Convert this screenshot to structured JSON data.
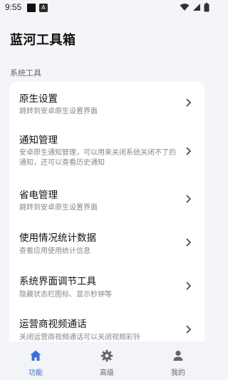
{
  "status_bar": {
    "time": "9:55",
    "notif_icon_2_glyph": "A"
  },
  "app": {
    "title": "蓝河工具箱"
  },
  "section": {
    "title": "系统工具"
  },
  "items": [
    {
      "title": "原生设置",
      "subtitle": "跳转到安卓原生设置界面"
    },
    {
      "title": "通知管理",
      "subtitle": "安卓原生通知管理，可以用来关闭系统关闭不了的通知，还可以查看历史通知"
    },
    {
      "title": "省电管理",
      "subtitle": "跳转到安卓原生设置界面"
    },
    {
      "title": "使用情况统计数据",
      "subtitle": "查看应用使用统计信息"
    },
    {
      "title": "系统界面调节工具",
      "subtitle": "隐藏状态栏图标、显示秒钟等"
    },
    {
      "title": "运营商视频通话",
      "subtitle": "关闭运营商视频通话可以关闭视频彩铃"
    }
  ],
  "bottom_nav": {
    "items": [
      {
        "label": "功能",
        "icon": "home-icon",
        "active": true
      },
      {
        "label": "高级",
        "icon": "gear-icon",
        "active": false
      },
      {
        "label": "我的",
        "icon": "person-icon",
        "active": false
      }
    ]
  },
  "colors": {
    "accent": "#3a6fd8",
    "inactive": "#666666",
    "background": "#f4f5f8",
    "card": "#ffffff"
  }
}
